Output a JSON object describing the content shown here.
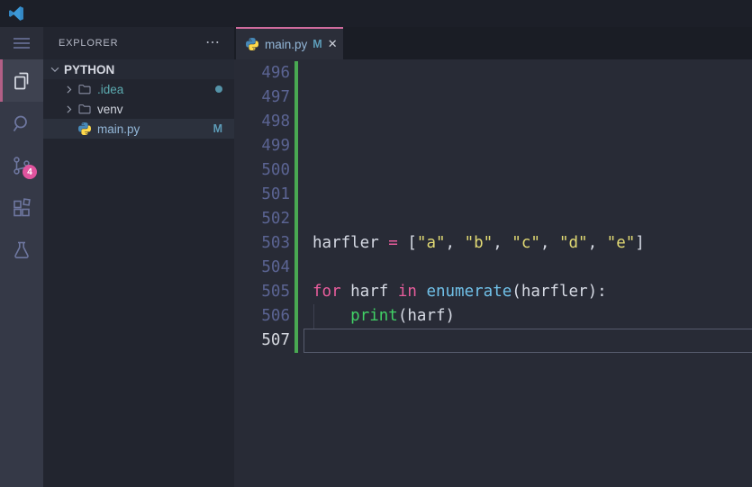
{
  "theme": {
    "titlebarBg": "#1c1f28",
    "activityBg": "#353947",
    "activityTopBg": "#2a2d38",
    "activityActiveBg": "#3e4250",
    "accentPinkBar": "#b25f86",
    "iconMuted": "#6e77a0",
    "iconActive": "#d7dbe4",
    "badgePink": "#e0549e",
    "sidebarBg": "#22252f",
    "sbHeaderFg": "#b4b8c5",
    "rowRootBg": "#262a35",
    "rowSelBg": "#2c313d",
    "tealFg": "#5cabb0",
    "tealDot": "#5593a8",
    "gitModFg": "#93b7d8",
    "gitModBadge": "#5d9cb8",
    "tabbarBg": "#1a1d25",
    "tabBg": "#2b2e39",
    "tabAccent": "#cf6b9d",
    "editorBg": "#282b36",
    "lineNum": "#5b6493",
    "lineNumActive": "#d6d9e0",
    "gitAdded": "#49a852",
    "curLineBorder": "#565b6d",
    "synKeyword": "#e85d9c",
    "synString": "#e2da74",
    "synFunction": "#70c0e8",
    "synBuiltin": "#41d065",
    "synPlain": "#d6dae4"
  },
  "titlebar": {
    "logo": "vscode-logo"
  },
  "activity_bar": {
    "items": [
      {
        "name": "menu",
        "icon": "hamburger-icon"
      },
      {
        "name": "explorer",
        "icon": "files-icon",
        "active": true
      },
      {
        "name": "search",
        "icon": "search-icon"
      },
      {
        "name": "source-control",
        "icon": "source-control-icon",
        "badge": "4"
      },
      {
        "name": "extensions",
        "icon": "extensions-icon"
      },
      {
        "name": "testing",
        "icon": "flask-icon"
      }
    ]
  },
  "sidebar": {
    "header": "EXPLORER",
    "more_glyph": "⋯",
    "root_label": "PYTHON",
    "items": [
      {
        "label": ".idea",
        "type": "folder",
        "badge": "dot"
      },
      {
        "label": "venv",
        "type": "folder"
      },
      {
        "label": "main.py",
        "type": "python-file",
        "selected": true,
        "badge": "M"
      }
    ]
  },
  "editor": {
    "tab": {
      "label": "main.py",
      "modified": "M",
      "close_glyph": "✕"
    },
    "lines": [
      {
        "num": "496",
        "tokens": []
      },
      {
        "num": "497",
        "tokens": []
      },
      {
        "num": "498",
        "tokens": []
      },
      {
        "num": "499",
        "tokens": []
      },
      {
        "num": "500",
        "tokens": []
      },
      {
        "num": "501",
        "tokens": []
      },
      {
        "num": "502",
        "tokens": []
      },
      {
        "num": "503",
        "tokens": [
          {
            "t": "harfler ",
            "c": "plain"
          },
          {
            "t": "=",
            "c": "kw"
          },
          {
            "t": " [",
            "c": "plain"
          },
          {
            "t": "\"a\"",
            "c": "str"
          },
          {
            "t": ", ",
            "c": "plain"
          },
          {
            "t": "\"b\"",
            "c": "str"
          },
          {
            "t": ", ",
            "c": "plain"
          },
          {
            "t": "\"c\"",
            "c": "str"
          },
          {
            "t": ", ",
            "c": "plain"
          },
          {
            "t": "\"d\"",
            "c": "str"
          },
          {
            "t": ", ",
            "c": "plain"
          },
          {
            "t": "\"e\"",
            "c": "str"
          },
          {
            "t": "]",
            "c": "plain"
          }
        ]
      },
      {
        "num": "504",
        "tokens": []
      },
      {
        "num": "505",
        "tokens": [
          {
            "t": "for",
            "c": "kw"
          },
          {
            "t": " harf ",
            "c": "plain"
          },
          {
            "t": "in",
            "c": "kw"
          },
          {
            "t": " ",
            "c": "plain"
          },
          {
            "t": "enumerate",
            "c": "fn"
          },
          {
            "t": "(harfler):",
            "c": "plain"
          }
        ]
      },
      {
        "num": "506",
        "guide": true,
        "tokens": [
          {
            "t": "    ",
            "c": "plain"
          },
          {
            "t": "print",
            "c": "fnb"
          },
          {
            "t": "(harf)",
            "c": "plain"
          }
        ]
      },
      {
        "num": "507",
        "active": true,
        "tokens": []
      }
    ]
  }
}
